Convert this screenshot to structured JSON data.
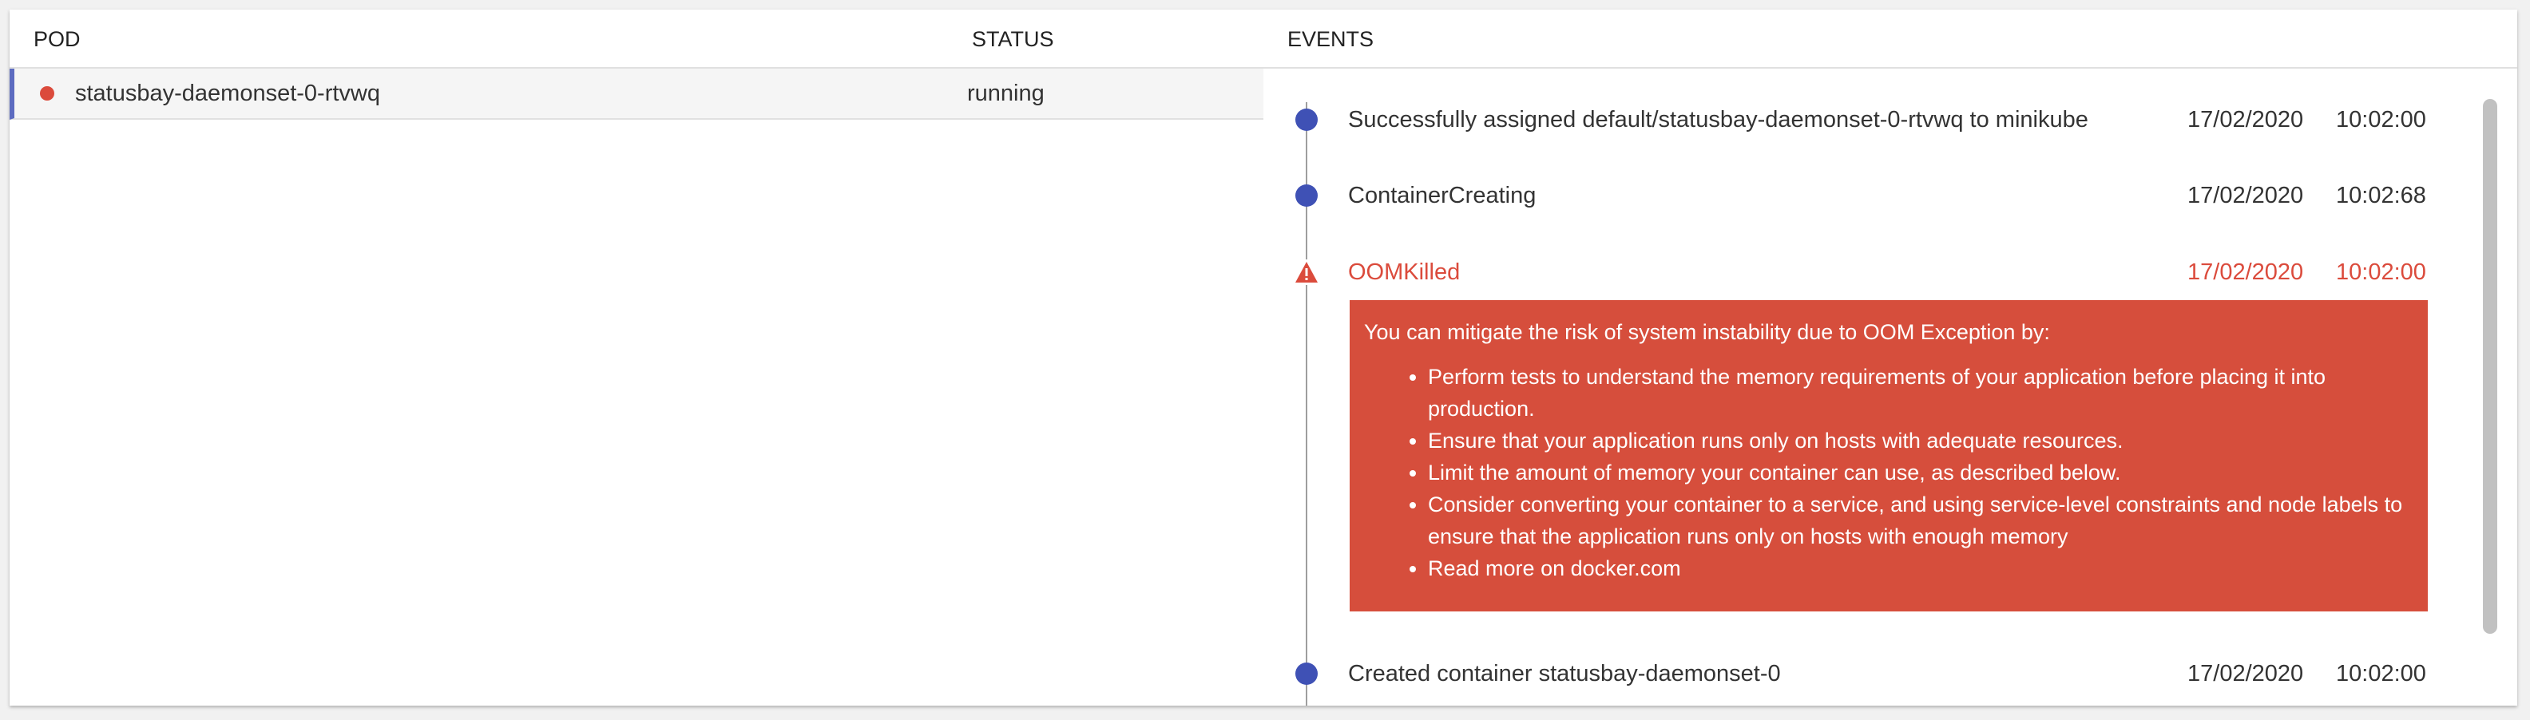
{
  "columns": {
    "pod": "POD",
    "status": "STATUS",
    "events": "EVENTS"
  },
  "pods": [
    {
      "name": "statusbay-daemonset-0-rtvwq",
      "status": "running",
      "status_color": "#db4b3c"
    }
  ],
  "events": [
    {
      "text": "Successfully assigned default/statusbay-daemonset-0-rtvwq to minikube",
      "date": "17/02/2020",
      "time": "10:02:00",
      "icon": "circle-icon"
    },
    {
      "text": "ContainerCreating",
      "date": "17/02/2020",
      "time": "10:02:68",
      "icon": "circle-icon"
    },
    {
      "text": "OOMKilled",
      "date": "17/02/2020",
      "time": "10:02:00",
      "icon": "warning-icon"
    },
    {
      "text": "Created container statusbay-daemonset-0",
      "date": "17/02/2020",
      "time": "10:02:00",
      "icon": "circle-icon"
    }
  ],
  "oom_alert": {
    "intro": "You can mitigate the risk of system instability due to OOM Exception by:",
    "items": [
      "Perform tests to understand the memory requirements of your application before placing it into production.",
      "Ensure that your application runs only on hosts with adequate resources.",
      "Limit the amount of memory your container can use, as described below.",
      "Consider converting your container to a service, and using service-level constraints and node labels to ensure that the application runs only on hosts with enough memory",
      "Read more on docker.com"
    ]
  },
  "colors": {
    "accent": "#3f51b5",
    "danger": "#db4b3c",
    "alert_bg": "#d64e3c"
  }
}
